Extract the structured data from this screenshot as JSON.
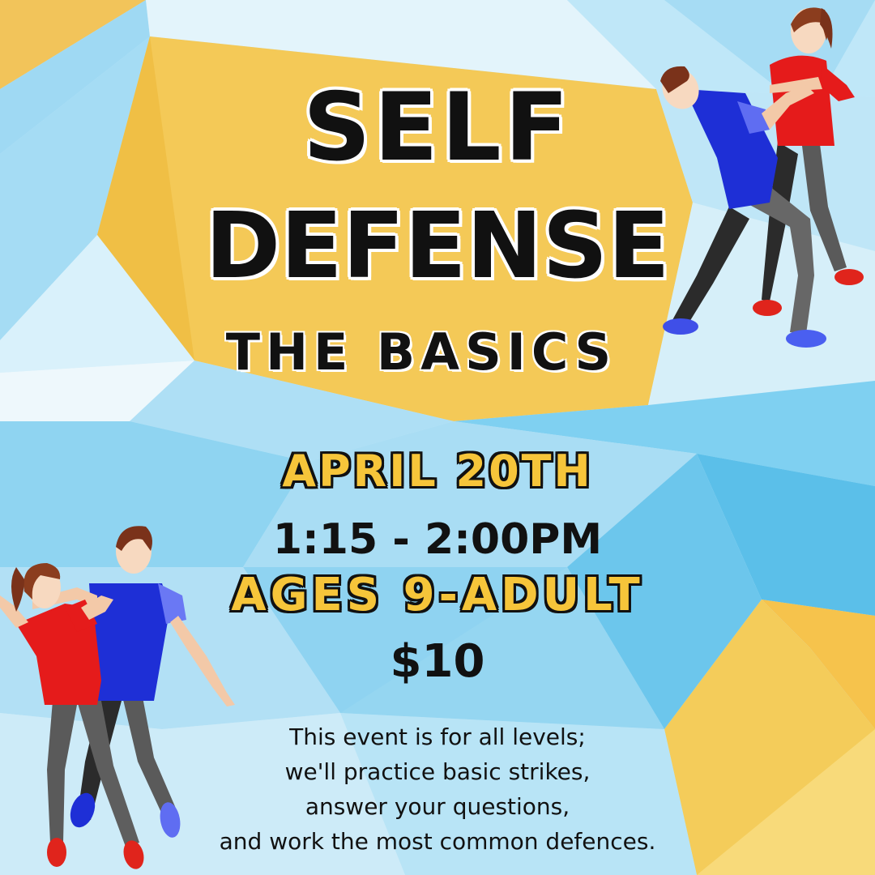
{
  "title_line_1": "SELF",
  "title_line_2": "DEFENSE",
  "subtitle": "THE BASICS",
  "date": "APRIL 20TH",
  "time": "1:15 - 2:00PM",
  "ages": "AGES 9-ADULT",
  "price": "$10",
  "description_lines": [
    "This event is for all levels;",
    "we'll practice basic strikes,",
    "answer your questions,",
    "and work the most common defences."
  ],
  "colors": {
    "accent_yellow": "#f6c53a",
    "sky_light": "#bfe6f7",
    "sky_mid": "#7dcdf0",
    "shirt_red": "#e51b1b",
    "shirt_blue": "#1e2fd6",
    "text_dark": "#111111"
  },
  "illustrations": [
    "self-defense-pair-top-right-illustration",
    "self-defense-pair-bottom-left-illustration"
  ]
}
